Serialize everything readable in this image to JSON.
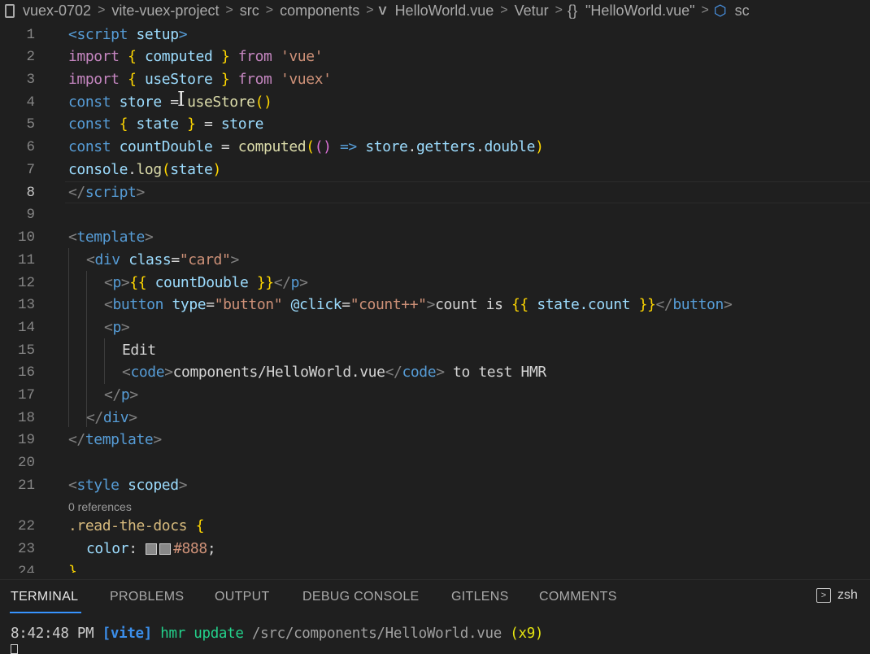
{
  "breadcrumb": {
    "items": [
      "vuex-0702",
      "vite-vuex-project",
      "src",
      "components",
      "HelloWorld.vue",
      "Vetur",
      "\"HelloWorld.vue\"",
      "sc"
    ],
    "separator": ">"
  },
  "editor": {
    "active_line": "8",
    "line_numbers": [
      "1",
      "2",
      "3",
      "4",
      "5",
      "6",
      "7",
      "8",
      "9",
      "10",
      "11",
      "12",
      "13",
      "14",
      "15",
      "16",
      "17",
      "18",
      "19",
      "20",
      "21",
      "22",
      "23",
      "24"
    ],
    "codelens": "0 references",
    "code": {
      "l1": {
        "open": "<",
        "tag": "script",
        "attr": "setup",
        "close": ">"
      },
      "l2": {
        "kw1": "import",
        "b1": "{",
        "name": "computed",
        "b2": "}",
        "kw2": "from",
        "str": "'vue'"
      },
      "l3": {
        "kw1": "import",
        "b1": "{",
        "name": "useStore",
        "b2": "}",
        "kw2": "from",
        "str": "'vuex'"
      },
      "l4": {
        "kw": "const",
        "name": "store",
        "eq": "=",
        "fn": "useStore",
        "b1": "(",
        "b2": ")"
      },
      "l5": {
        "kw": "const",
        "b1": "{",
        "name": "state",
        "b2": "}",
        "eq": "=",
        "val": "store"
      },
      "l6": {
        "kw": "const",
        "name": "countDouble",
        "eq": "=",
        "fn": "computed",
        "p1": "(",
        "p2": "()",
        "arrow": "=>",
        "obj": "store",
        "dot1": ".",
        "prop1": "getters",
        "dot2": ".",
        "prop2": "double",
        "p3": ")"
      },
      "l7": {
        "obj": "console",
        "dot": ".",
        "fn": "log",
        "p1": "(",
        "arg": "state",
        "p2": ")"
      },
      "l8": {
        "open": "</",
        "tag": "script",
        "close": ">"
      },
      "l10": {
        "open": "<",
        "tag": "template",
        "close": ">"
      },
      "l11": {
        "open": "<",
        "tag": "div",
        "attr": "class",
        "eq": "=",
        "str": "\"card\"",
        "close": ">"
      },
      "l12": {
        "open": "<",
        "tag": "p",
        "close": ">",
        "m1": "{{",
        "expr": "countDouble",
        "m2": "}}",
        "open2": "</",
        "tag2": "p",
        "close2": ">"
      },
      "l13": {
        "open": "<",
        "tag": "button",
        "attr1": "type",
        "eq1": "=",
        "str1": "\"button\"",
        "attr2": "@click",
        "eq2": "=",
        "str2": "\"count++\"",
        "close": ">",
        "text": "count is ",
        "m1": "{{",
        "expr": "state.count",
        "m2": "}}",
        "open2": "</",
        "tag2": "button",
        "close2": ">"
      },
      "l14": {
        "open": "<",
        "tag": "p",
        "close": ">"
      },
      "l15": {
        "text": "Edit"
      },
      "l16": {
        "open": "<",
        "tag": "code",
        "close": ">",
        "text": "components/HelloWorld.vue",
        "open2": "</",
        "tag2": "code",
        "close2": ">",
        "text2": " to test HMR"
      },
      "l17": {
        "open": "</",
        "tag": "p",
        "close": ">"
      },
      "l18": {
        "open": "</",
        "tag": "div",
        "close": ">"
      },
      "l19": {
        "open": "</",
        "tag": "template",
        "close": ">"
      },
      "l21": {
        "open": "<",
        "tag": "style",
        "attr": "scoped",
        "close": ">"
      },
      "l22": {
        "sel": ".read-the-docs",
        "b": "{"
      },
      "l23": {
        "prop": "color",
        "colon": ":",
        "val": "#888",
        "semi": ";"
      },
      "l24": {
        "b": "}"
      }
    }
  },
  "panel": {
    "tabs": [
      "TERMINAL",
      "PROBLEMS",
      "OUTPUT",
      "DEBUG CONSOLE",
      "GITLENS",
      "COMMENTS"
    ],
    "active_tab": "TERMINAL",
    "shell": "zsh"
  },
  "terminal": {
    "time": "8:42:48 PM",
    "tag": "[vite]",
    "msg": "hmr update",
    "path": "/src/components/HelloWorld.vue",
    "count": "(x9)"
  },
  "colors": {
    "background": "#1f1f1f",
    "accent": "#3794ff",
    "swatch": "#888888"
  },
  "icons": [
    "file-icon",
    "vue-icon",
    "braces-icon",
    "cube-icon",
    "text-cursor-icon",
    "terminal-shell-icon"
  ]
}
